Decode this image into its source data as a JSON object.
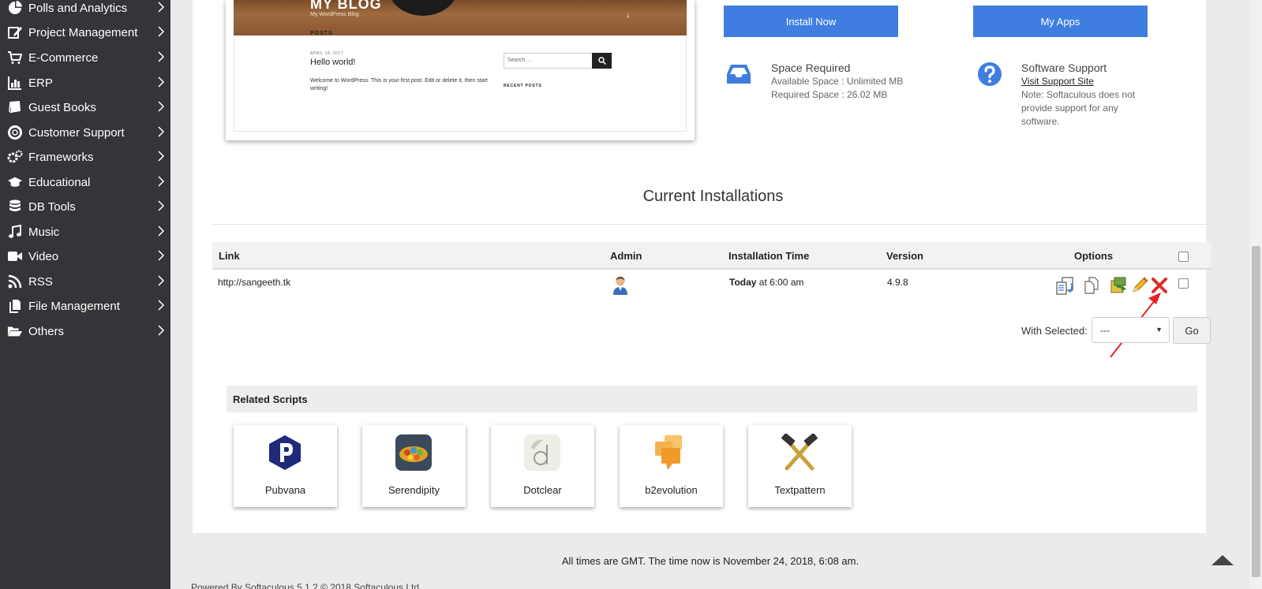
{
  "sidebar": {
    "items": [
      {
        "label": "Polls and Analytics",
        "icon": "pie-chart-icon"
      },
      {
        "label": "Project Management",
        "icon": "edit-icon"
      },
      {
        "label": "E-Commerce",
        "icon": "shopping-cart-icon"
      },
      {
        "label": "ERP",
        "icon": "bar-chart-icon"
      },
      {
        "label": "Guest Books",
        "icon": "book-icon"
      },
      {
        "label": "Customer Support",
        "icon": "life-ring-icon"
      },
      {
        "label": "Frameworks",
        "icon": "cogs-icon"
      },
      {
        "label": "Educational",
        "icon": "graduation-cap-icon"
      },
      {
        "label": "DB Tools",
        "icon": "database-icon"
      },
      {
        "label": "Music",
        "icon": "music-icon"
      },
      {
        "label": "Video",
        "icon": "video-camera-icon"
      },
      {
        "label": "RSS",
        "icon": "rss-icon"
      },
      {
        "label": "File Management",
        "icon": "files-icon"
      },
      {
        "label": "Others",
        "icon": "folder-open-icon"
      }
    ]
  },
  "preview": {
    "blog_title": "MY BLOG",
    "blog_subtitle": "My WordPress Blog",
    "posts_heading": "POSTS",
    "post_date": "APRIL 18, 2017",
    "post_title": "Hello world!",
    "post_body": "Welcome to WordPress. This is your first post. Edit or delete it, then start writing!",
    "search_placeholder": "Search ...",
    "recent_posts_heading": "RECENT POSTS"
  },
  "actions": {
    "install_label": "Install Now",
    "myapps_label": "My Apps"
  },
  "space": {
    "title": "Space Required",
    "available": "Available Space : Unlimited MB",
    "required": "Required Space : 26.02 MB"
  },
  "support": {
    "title": "Software Support",
    "link": "Visit Support Site",
    "note_line1": "Note: Softaculous does not",
    "note_line2": "provide support for any",
    "note_line3": "software."
  },
  "installations": {
    "title": "Current Installations",
    "columns": {
      "link": "Link",
      "admin": "Admin",
      "time": "Installation Time",
      "version": "Version",
      "options": "Options"
    },
    "rows": [
      {
        "link": "http://sangeeth.tk",
        "time_bold": "Today",
        "time_rest": " at 6:00 am",
        "version": "4.9.8"
      }
    ],
    "with_selected_label": "With Selected:",
    "with_selected_value": "---",
    "go_label": "Go"
  },
  "related": {
    "title": "Related Scripts",
    "scripts": [
      {
        "name": "Pubvana"
      },
      {
        "name": "Serendipity"
      },
      {
        "name": "Dotclear"
      },
      {
        "name": "b2evolution"
      },
      {
        "name": "Textpattern"
      }
    ]
  },
  "footer": {
    "time_note": "All times are GMT. The time now is November 24, 2018, 6:08 am.",
    "powered": "Powered By Softaculous 5.1.2 © 2018 Softaculous Ltd."
  },
  "colors": {
    "sidebar_bg": "#333538",
    "accent_blue": "#3f7ee0",
    "delete_red": "#d9302c"
  }
}
